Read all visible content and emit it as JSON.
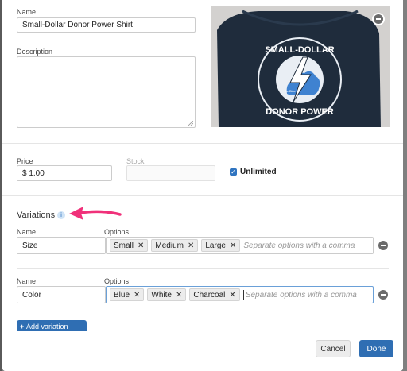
{
  "product": {
    "name_label": "Name",
    "name_value": "Small-Dollar Donor Power Shirt",
    "description_label": "Description",
    "description_value": "",
    "image": {
      "shirt_text_top": "SMALL-DOLLAR",
      "shirt_text_bottom": "DONOR POWER",
      "badge_text": "ActBlue"
    }
  },
  "pricing": {
    "price_label": "Price",
    "price_value": "$ 1.00",
    "stock_label": "Stock",
    "stock_value": "",
    "unlimited_label": "Unlimited",
    "unlimited_checked": true
  },
  "variations": {
    "title": "Variations",
    "info_icon": "i",
    "rows": [
      {
        "name_label": "Name",
        "options_label": "Options",
        "name_value": "Size",
        "options": [
          "Small",
          "Medium",
          "Large"
        ],
        "placeholder": "Separate options with a comma"
      },
      {
        "name_label": "Name",
        "options_label": "Options",
        "name_value": "Color",
        "options": [
          "Blue",
          "White",
          "Charcoal"
        ],
        "placeholder": "Separate options with a comma"
      }
    ],
    "add_button_label": "Add variation"
  },
  "footer": {
    "cancel_label": "Cancel",
    "done_label": "Done"
  },
  "colors": {
    "primary": "#2f6eb3",
    "annotation_arrow": "#f0317a"
  }
}
